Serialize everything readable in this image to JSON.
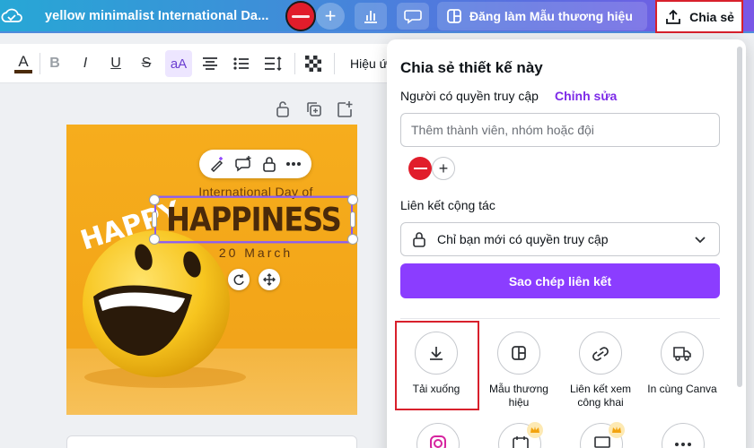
{
  "header": {
    "design_title": "yellow minimalist International Da...",
    "brand_template_label": "Đăng làm Mẫu thương hiệu",
    "share_label": "Chia sẻ"
  },
  "toolbar": {
    "effect_label": "Hiệu ứ"
  },
  "design": {
    "subtitle": "International Day of",
    "headline": "HAPPINESS",
    "date": "20  March",
    "happy_text": "HAPPY"
  },
  "share_panel": {
    "title": "Chia sẻ thiết kế này",
    "access_label": "Người có quyền truy cập",
    "edit_link": "Chỉnh sửa",
    "member_placeholder": "Thêm thành viên, nhóm hoặc đội",
    "collab_label": "Liên kết cộng tác",
    "access_value": "Chỉ bạn mới có quyền truy cập",
    "copy_button": "Sao chép liên kết",
    "options": [
      {
        "label": "Tải xuống",
        "icon": "download-icon"
      },
      {
        "label": "Mẫu thương hiệu",
        "icon": "brand-template-icon"
      },
      {
        "label": "Liên kết xem công khai",
        "icon": "link-icon"
      },
      {
        "label": "In cùng Canva",
        "icon": "truck-icon"
      }
    ]
  },
  "colors": {
    "accent_purple": "#8b3dff",
    "highlight_red": "#d8202c",
    "design_yellow": "#f6ad1d"
  }
}
